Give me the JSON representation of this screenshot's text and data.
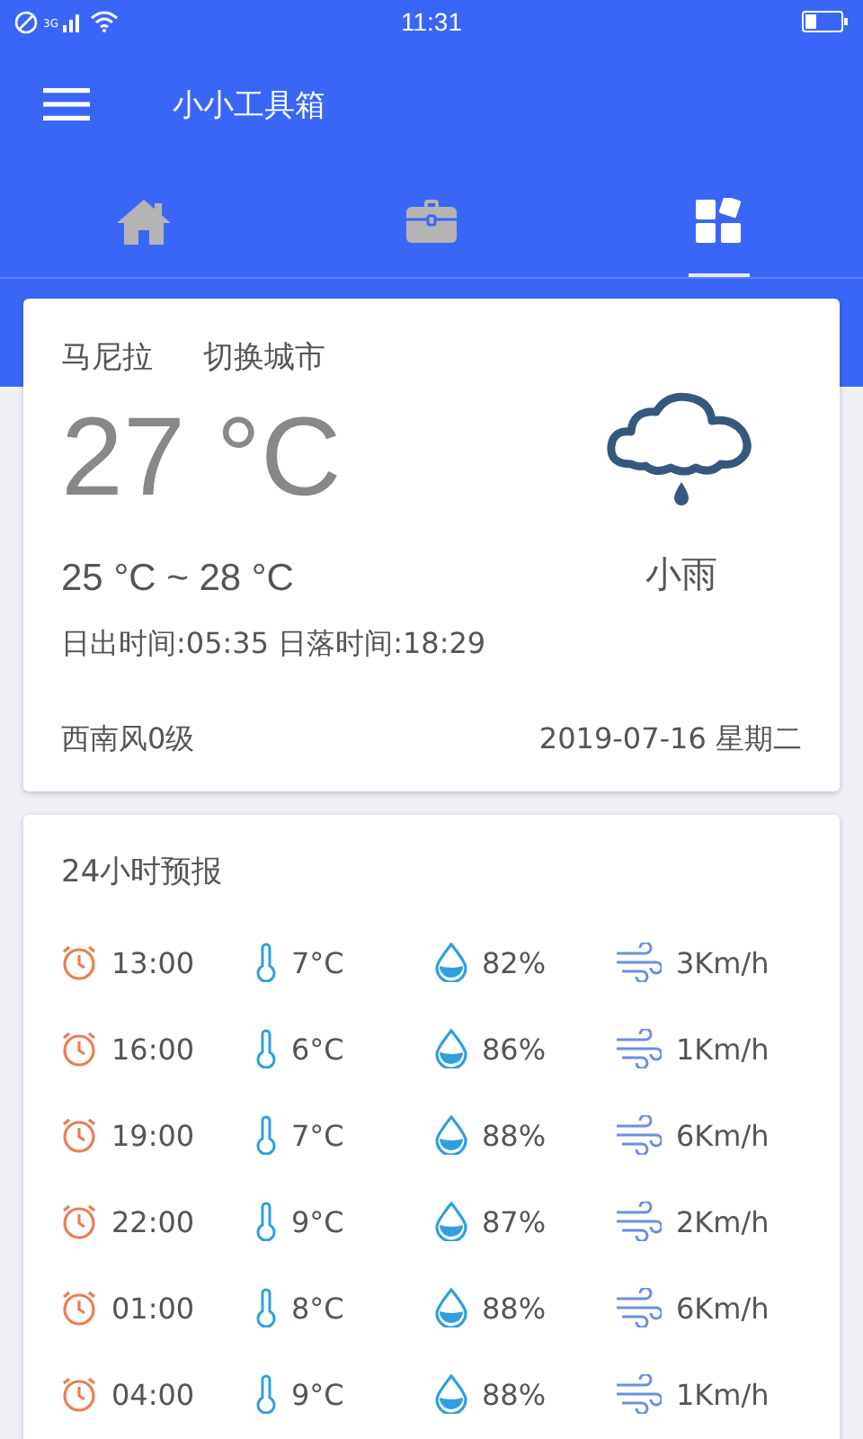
{
  "status_bar": {
    "time": "11:31",
    "network": "3G"
  },
  "toolbar": {
    "title": "小小工具箱"
  },
  "tabs": [
    {
      "selected": false
    },
    {
      "selected": false
    },
    {
      "selected": true
    }
  ],
  "weather": {
    "city": "马尼拉",
    "switch_city": "切换城市",
    "temperature": "27 °C",
    "range": "25 °C ~ 28 °C",
    "sun": "日出时间:05:35 日落时间:18:29",
    "wind": "西南风0级",
    "date": "2019-07-16 星期二",
    "condition": "小雨"
  },
  "forecast": {
    "title": "24小时预报",
    "rows": [
      {
        "time": "13:00",
        "temp": "7°C",
        "humidity": "82%",
        "wind": "3Km/h"
      },
      {
        "time": "16:00",
        "temp": "6°C",
        "humidity": "86%",
        "wind": "1Km/h"
      },
      {
        "time": "19:00",
        "temp": "7°C",
        "humidity": "88%",
        "wind": "6Km/h"
      },
      {
        "time": "22:00",
        "temp": "9°C",
        "humidity": "87%",
        "wind": "2Km/h"
      },
      {
        "time": "01:00",
        "temp": "8°C",
        "humidity": "88%",
        "wind": "6Km/h"
      },
      {
        "time": "04:00",
        "temp": "9°C",
        "humidity": "88%",
        "wind": "1Km/h"
      }
    ]
  }
}
